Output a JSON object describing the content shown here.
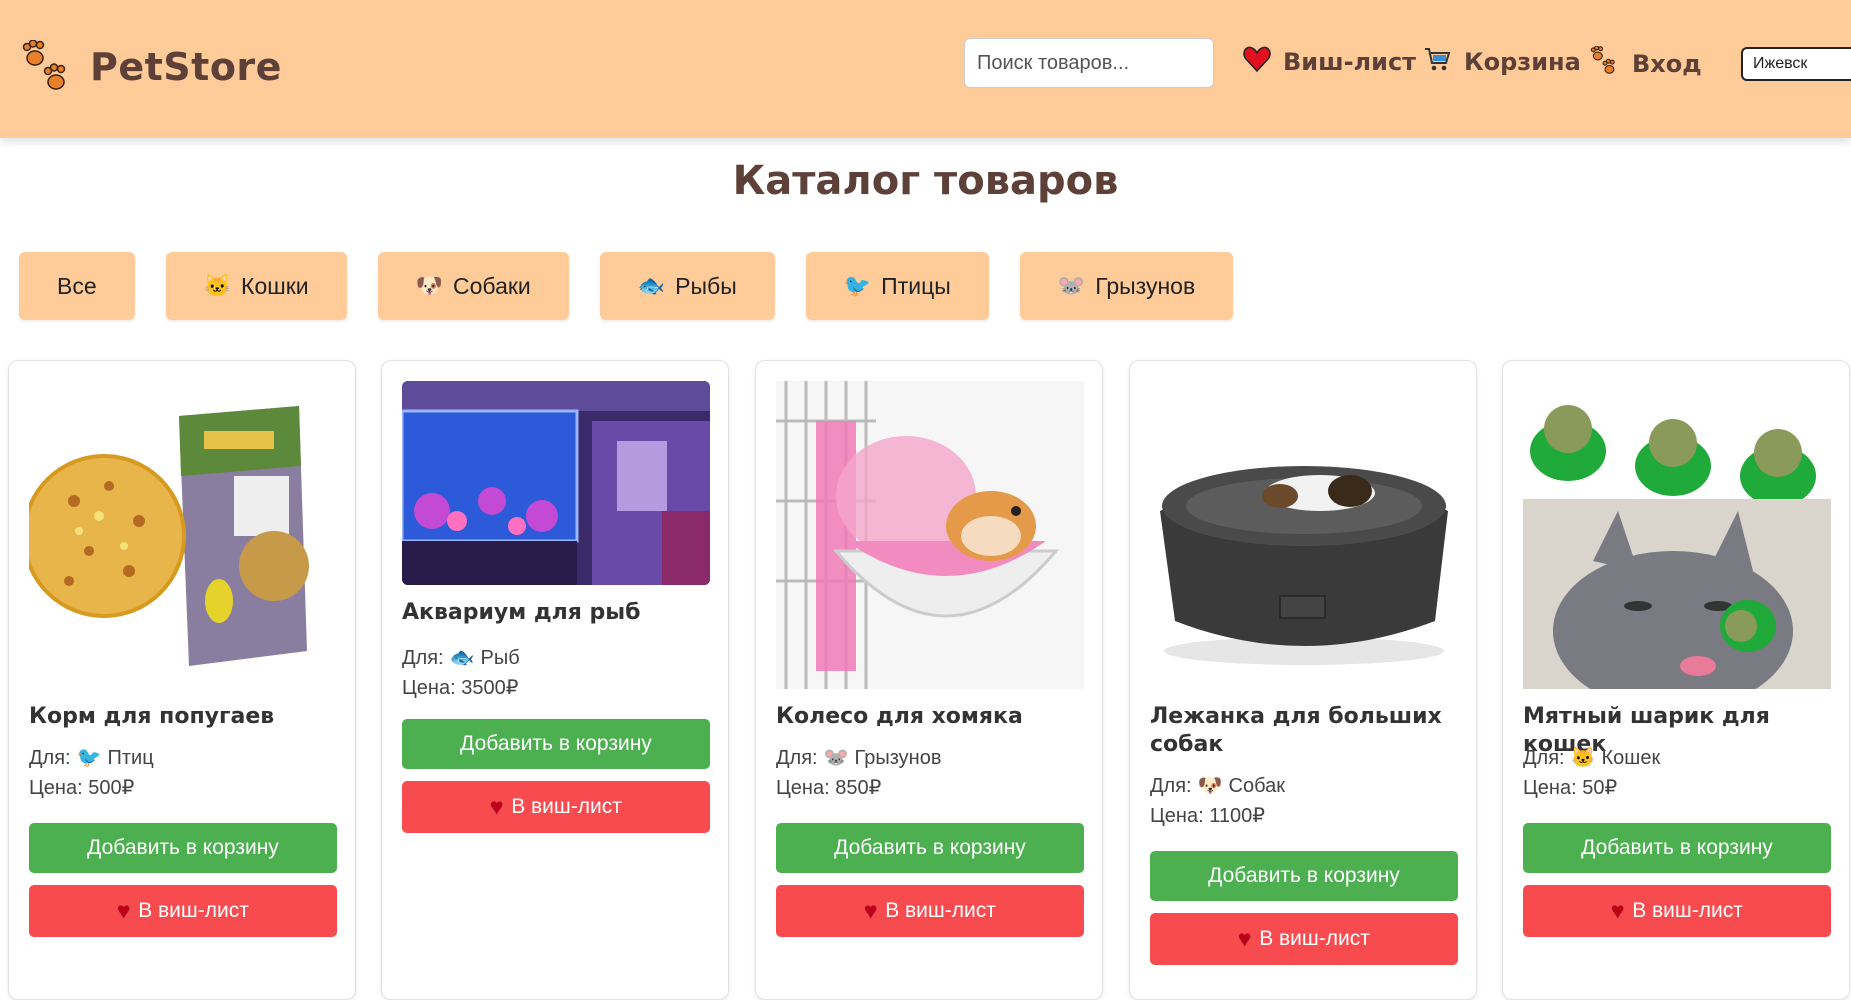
{
  "header": {
    "logo_text": "PetStore",
    "logo_icon": "paw-prints-icon",
    "search_placeholder": "Поиск товаров...",
    "nav": {
      "wishlist": "Виш-лист",
      "cart": "Корзина",
      "login": "Вход"
    },
    "city": "Ижевск",
    "colors": {
      "header_bg": "#ffcc99",
      "text": "#5d4037"
    }
  },
  "page_title": "Каталог товаров",
  "filters": [
    {
      "label": "Все",
      "icon": ""
    },
    {
      "label": "Кошки",
      "icon": "cat-icon"
    },
    {
      "label": "Собаки",
      "icon": "dog-icon"
    },
    {
      "label": "Рыбы",
      "icon": "fish-icon"
    },
    {
      "label": "Птицы",
      "icon": "parrot-icon"
    },
    {
      "label": "Грызунов",
      "icon": "mouse-icon"
    }
  ],
  "for_label": "Для:",
  "price_label": "Цена:",
  "products": [
    {
      "title": "Корм для попугаев",
      "for": "Птиц",
      "for_icon": "parrot-icon",
      "price": "500₽"
    },
    {
      "title": "Аквариум для рыб",
      "for": "Рыб",
      "for_icon": "fish-icon",
      "price": "3500₽"
    },
    {
      "title": "Колесо для хомяка",
      "for": "Грызунов",
      "for_icon": "mouse-icon",
      "price": "850₽"
    },
    {
      "title": "Лежанка для больших собак",
      "for": "Собак",
      "for_icon": "dog-icon",
      "price": "1100₽"
    },
    {
      "title": "Мятный шарик для кошек",
      "for": "Кошек",
      "for_icon": "cat-icon",
      "price": "50₽"
    }
  ],
  "buttons": {
    "add_to_cart": "Добавить в корзину",
    "to_wishlist": "В виш-лист"
  },
  "colors": {
    "cart_button": "#4caf50",
    "wish_button": "#f84b4f",
    "filter_bg": "#ffcc99"
  }
}
